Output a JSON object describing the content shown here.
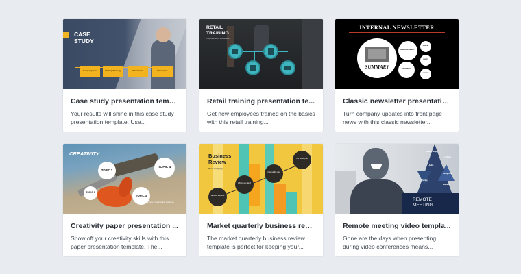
{
  "cards": [
    {
      "title": "Case study presentation templ...",
      "description": "Your results will shine in this case study presentation template. Use...",
      "thumb": {
        "heading_line1": "CASE",
        "heading_line2": "STUDY",
        "folders": [
          "Company Info",
          "Pricing Strategy",
          "Placement",
          "Promotion"
        ]
      }
    },
    {
      "title": "Retail training presentation te...",
      "description": "Get new employees trained on the basics with this retail training...",
      "thumb": {
        "heading_line1": "RETAIL",
        "heading_line2": "TRAINING",
        "sub": "Corporate Name Presentation"
      }
    },
    {
      "title": "Classic newsletter presentatio...",
      "description": "Turn company updates into front page news with this classic newsletter...",
      "thumb": {
        "heading": "INTERNAL NEWSLETTER",
        "summary": "SUMMARY",
        "bubbles": [
          "ANNOUNCEMENTS",
          "UPDATES",
          "IN DEPTH",
          "EVENTS",
          "CONTACT"
        ]
      }
    },
    {
      "title": "Creativity paper presentation ...",
      "description": "Show off your creativity skills with this paper presentation template. The...",
      "thumb": {
        "heading": "CREATIVITY",
        "topics": [
          "TOPIC 1",
          "TOPIC 2",
          "TOPIC 3",
          "TOPIC 4"
        ],
        "credit": "Your name / Your company, Credit here"
      }
    },
    {
      "title": "Market quarterly business revi...",
      "description": "The market quarterly business review template is perfect for keeping your...",
      "thumb": {
        "heading_line1": "Business",
        "heading_line2": "Review",
        "sub": "Your company",
        "bubbles": [
          "Defining success",
          "Where we stand",
          "Closing the gap",
          "The action plan"
        ]
      }
    },
    {
      "title": "Remote meeting video templa...",
      "description": "Gone are the days when presenting during video conferences means...",
      "thumb": {
        "heading_line1": "REMOTE",
        "heading_line2": "MEETING",
        "tags": [
          "Camera Setup",
          "Lighting",
          "Audio",
          "Background",
          "Sharing",
          "Etiquette"
        ]
      }
    }
  ]
}
